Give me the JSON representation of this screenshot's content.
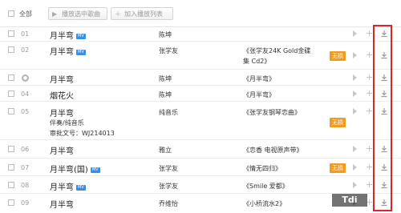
{
  "toolbar": {
    "select_all_label": "全部",
    "play_selected_label": "播放选中歌曲",
    "add_to_playlist_label": "加入播放列表",
    "play_icon": "play-icon",
    "plus_icon": "plus-icon"
  },
  "rows": [
    {
      "num": "01",
      "title": "月半弯",
      "badge": "MV",
      "sub1": "",
      "sub2": "",
      "artist": "陈坤",
      "album": "",
      "lossless": ""
    },
    {
      "num": "02",
      "title": "月半弯",
      "badge": "MV",
      "sub1": "",
      "sub2": "",
      "artist": "张学友",
      "album": "《张学友24K Gold金碟",
      "album2": "集 Cd2》",
      "lossless": "无损"
    },
    {
      "num": "",
      "title": "月半弯",
      "badge": "",
      "sub1": "",
      "sub2": "",
      "artist": "陈坤",
      "album": "《月半弯》",
      "lossless": ""
    },
    {
      "num": "04",
      "title": "烟花火",
      "badge": "",
      "sub1": "",
      "sub2": "",
      "artist": "陈坤",
      "album": "《月半弯》",
      "lossless": ""
    },
    {
      "num": "05",
      "title": "月半弯",
      "badge": "",
      "sub1": "伴奏/纯音乐",
      "sub2": "审批文号：WJ214013",
      "artist": "纯音乐",
      "album": "《张学友钢琴恋曲》",
      "lossless": "无损"
    },
    {
      "num": "06",
      "title": "月半弯",
      "badge": "",
      "sub1": "",
      "sub2": "",
      "artist": "雅立",
      "album": "《恋香 电视原声带》",
      "lossless": ""
    },
    {
      "num": "07",
      "title": "月半弯(国)",
      "badge": "MV",
      "sub1": "",
      "sub2": "",
      "artist": "张学友",
      "album": "《情无四归》",
      "lossless": "无损"
    },
    {
      "num": "08",
      "title": "月半弯",
      "badge": "MV",
      "sub1": "",
      "sub2": "",
      "artist": "张学友",
      "album": "《Smile 爱都》",
      "lossless": ""
    },
    {
      "num": "09",
      "title": "月半弯",
      "badge": "",
      "sub1": "",
      "sub2": "",
      "artist": "乔维怡",
      "album": "《小桥流水2》",
      "lossless": ""
    }
  ],
  "watermark": "Tdi",
  "colors": {
    "highlight_frame": "#d9262a",
    "lossless_badge": "#f39b1d",
    "mv_badge": "#3a8ee6"
  }
}
